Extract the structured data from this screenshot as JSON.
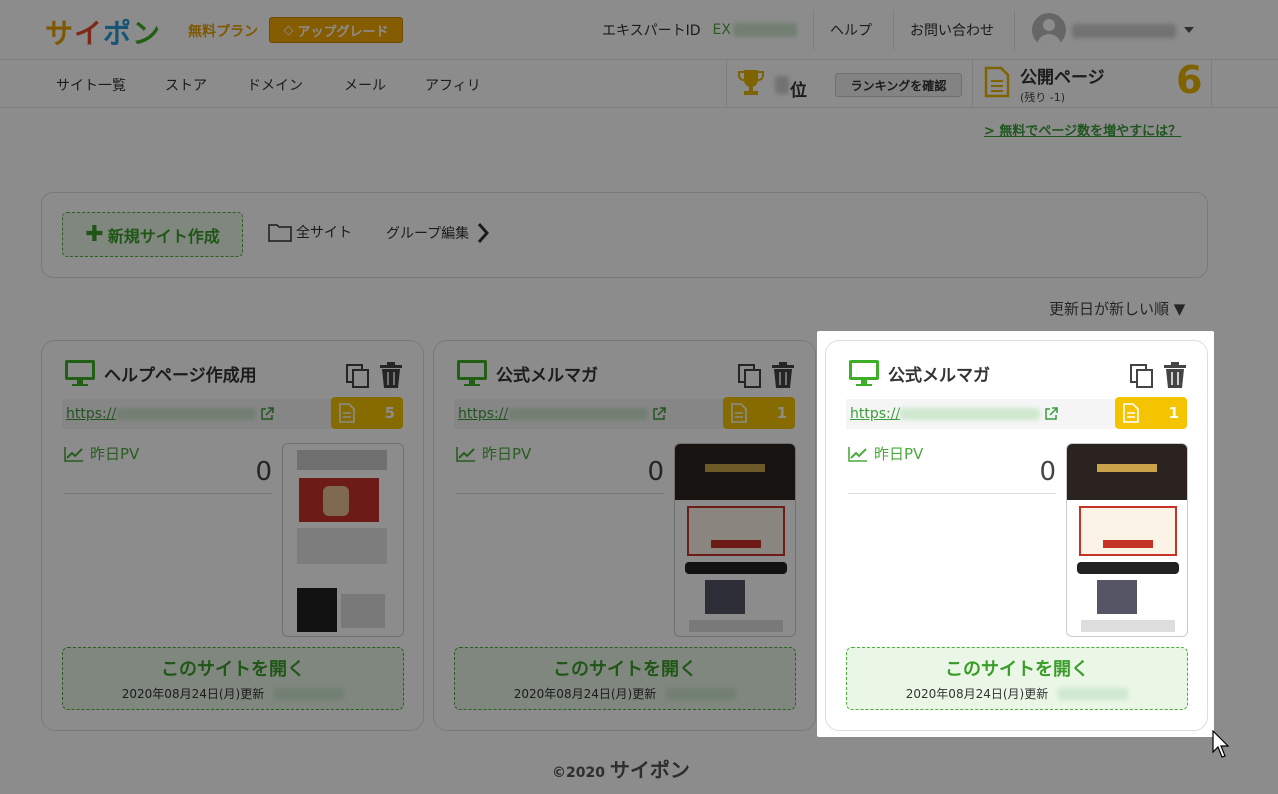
{
  "header": {
    "logo": "サイポン",
    "plan": "無料プラン",
    "upgrade_label": "アップグレード",
    "expert_id_label": "エキスパートID",
    "expert_id_prefix": "EX",
    "help": "ヘルプ",
    "contact": "お問い合わせ"
  },
  "nav": {
    "items": [
      "サイト一覧",
      "ストア",
      "ドメイン",
      "メール",
      "アフィリ"
    ]
  },
  "ranking": {
    "suffix": "位",
    "button_label": "ランキングを確認"
  },
  "public_pages": {
    "title": "公開ページ",
    "remaining": "(残り -1)",
    "count": "6",
    "more_link": "> 無料でページ数を増やすには？"
  },
  "actions": {
    "new_site": "新規サイト作成",
    "all_sites": "全サイト",
    "group_edit": "グループ編集"
  },
  "sort_label": "更新日が新しい順 ▼",
  "cards": [
    {
      "title": "ヘルプページ作成用",
      "url": "https://",
      "pages": "5",
      "pv_label": "昨日PV",
      "pv": "0",
      "open_label": "このサイトを開く",
      "updated": "2020年08月24日(月)更新"
    },
    {
      "title": "公式メルマガ",
      "url": "https://",
      "pages": "1",
      "pv_label": "昨日PV",
      "pv": "0",
      "open_label": "このサイトを開く",
      "updated": "2020年08月24日(月)更新"
    },
    {
      "title": "公式メルマガ",
      "url": "https://",
      "pages": "1",
      "pv_label": "昨日PV",
      "pv": "0",
      "open_label": "このサイトを開く",
      "updated": "2020年08月24日(月)更新"
    }
  ],
  "footer": {
    "copyright": "©2020",
    "brand": "サイポン"
  },
  "colors": {
    "accent_green": "#3a9d2a",
    "accent_yellow": "#f5c400",
    "upgrade": "#f5a800"
  }
}
